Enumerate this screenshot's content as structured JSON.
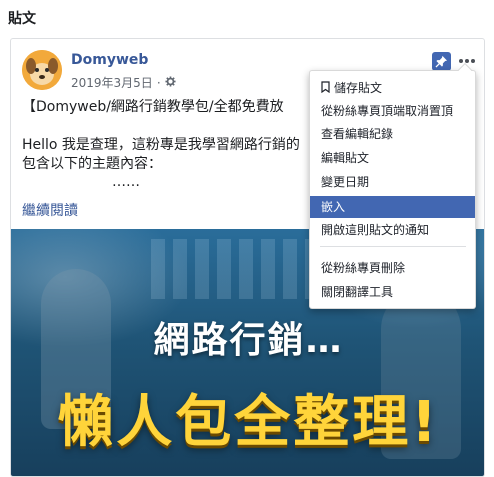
{
  "section": {
    "title": "貼文"
  },
  "post": {
    "page_name": "Domyweb",
    "date": "2019年3月5日",
    "dot": "·",
    "lines": [
      "【Domyweb/網路行銷教學包/全都免費放",
      "Hello 我是查理，這粉專是我學習網路行銷的",
      "包含以下的主題內容：",
      "……"
    ],
    "read_more": "繼續閱讀",
    "banner_line1": "網路行銷…",
    "banner_line2": "懶人包全整理!"
  },
  "menu": {
    "items": [
      {
        "label": "儲存貼文",
        "icon": "bookmark-icon"
      },
      {
        "label": "從粉絲專頁頂端取消置頂"
      },
      {
        "label": "查看編輯紀錄"
      },
      {
        "label": "編輯貼文"
      },
      {
        "label": "變更日期"
      },
      {
        "label": "嵌入",
        "active": true
      },
      {
        "label": "開啟這則貼文的通知"
      },
      {
        "label": "從粉絲專頁刪除"
      },
      {
        "label": "關閉翻譯工具"
      }
    ]
  },
  "colors": {
    "link": "#385898",
    "accent": "#4267b2",
    "banner_yellow": "#ffd43a"
  }
}
